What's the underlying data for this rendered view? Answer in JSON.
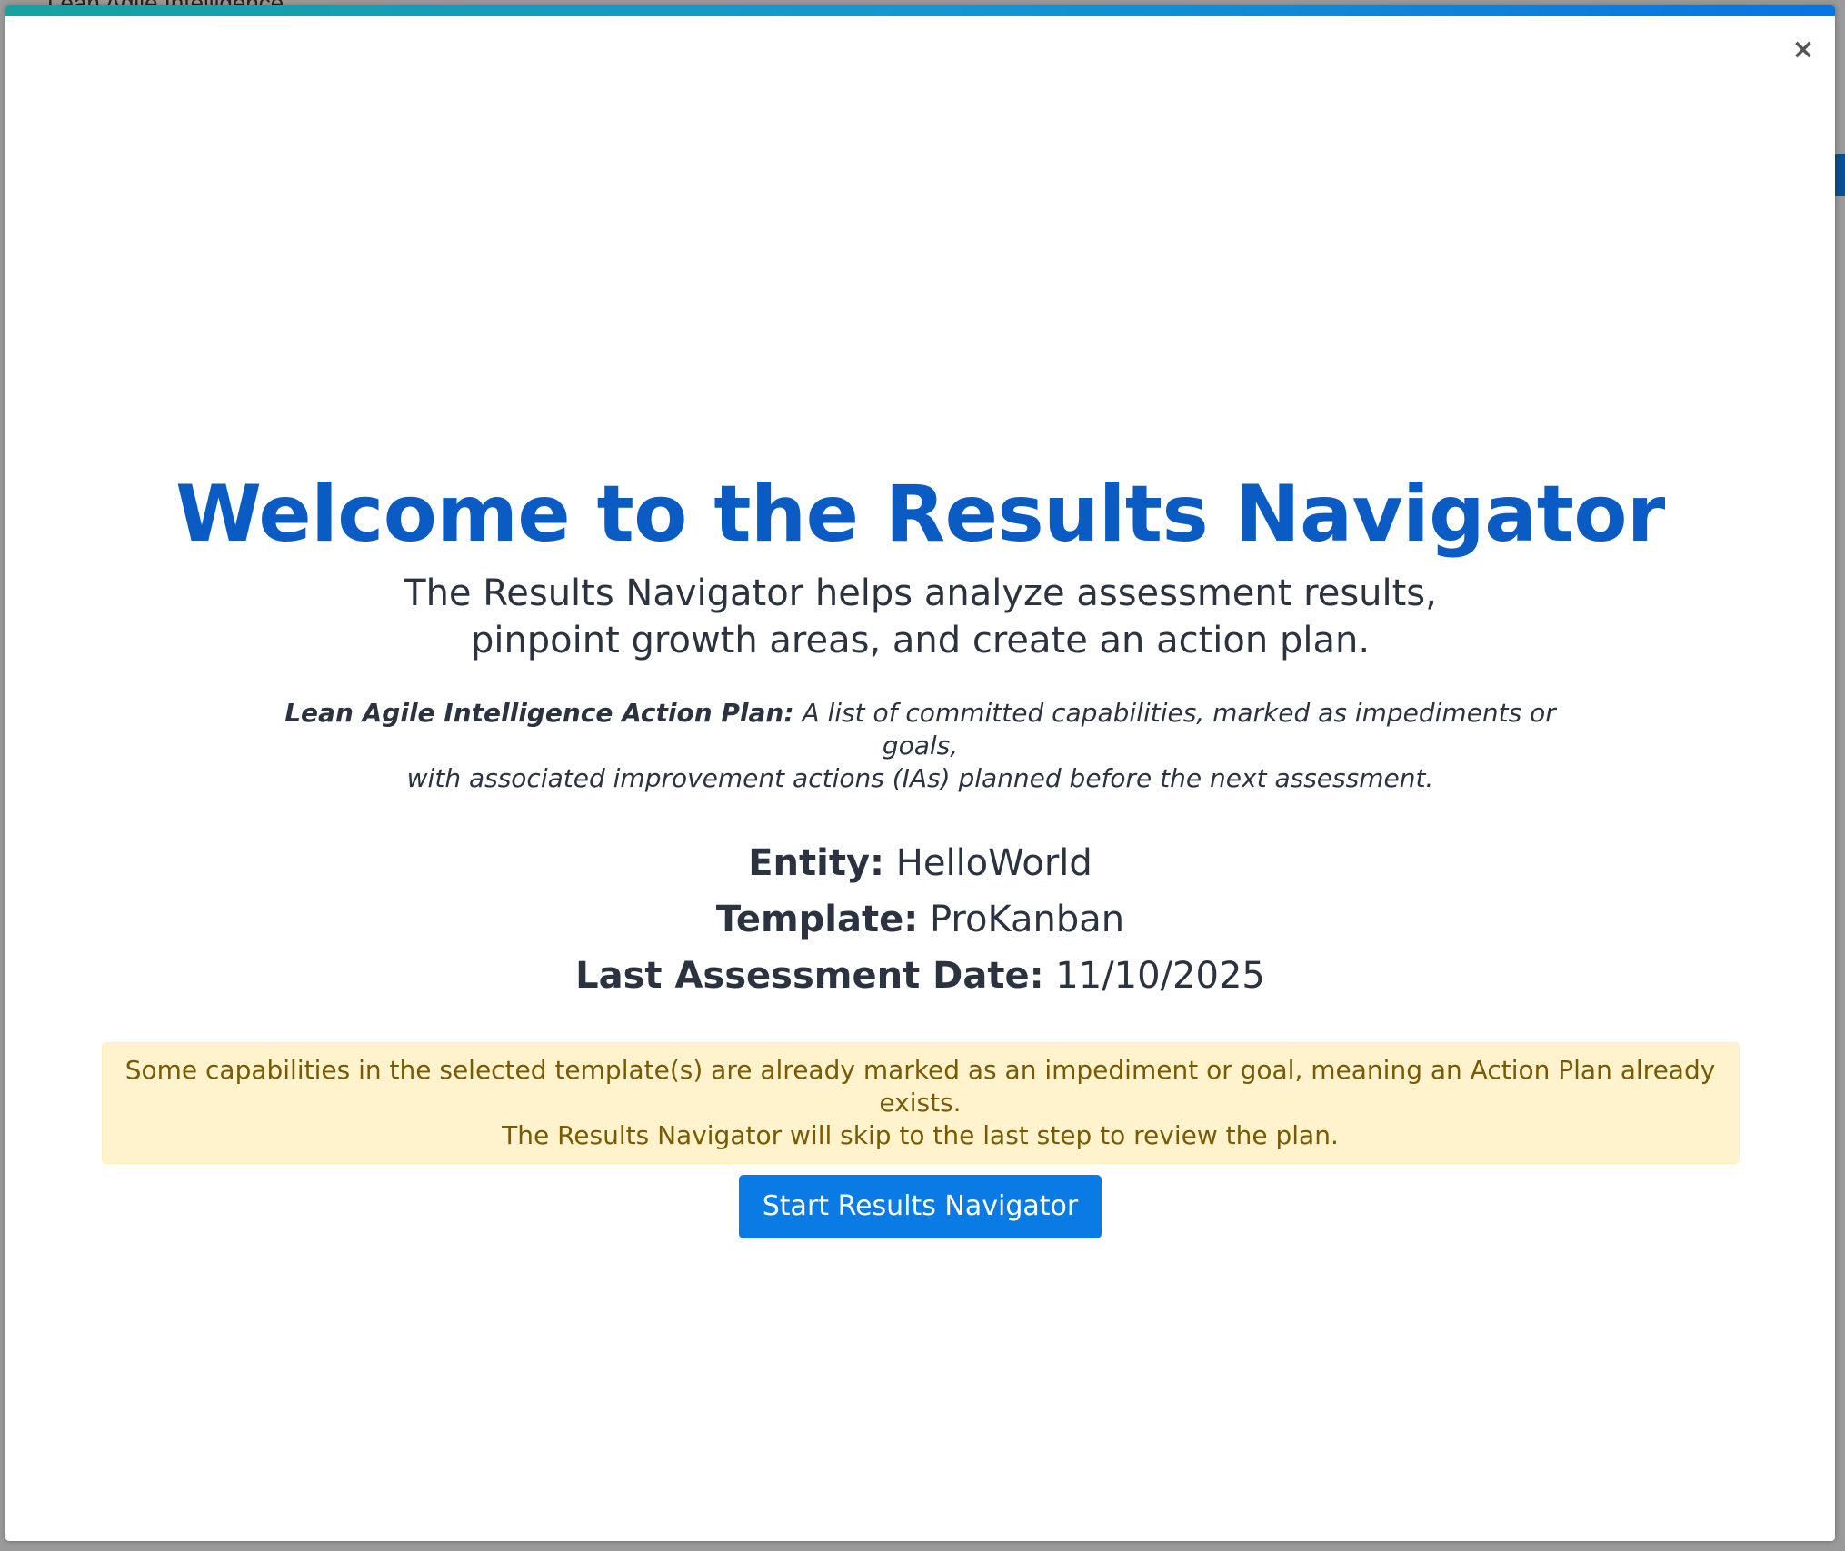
{
  "background": {
    "app_title": "Lean Agile Intelligence"
  },
  "modal": {
    "close_label": "×",
    "title": "Welcome to the Results Navigator",
    "subtitle_line1": "The Results Navigator helps analyze assessment results,",
    "subtitle_line2": "pinpoint growth areas, and create an action plan.",
    "definition_term": "Lean Agile Intelligence Action Plan:",
    "definition_text_line1": " A list of committed capabilities, marked as impediments or goals,",
    "definition_text_line2": "with associated improvement actions (IAs) planned before the next assessment.",
    "meta": {
      "entity_label": "Entity:",
      "entity_value": " HelloWorld",
      "template_label": "Template:",
      "template_value": " ProKanban",
      "date_label": "Last Assessment Date:",
      "date_value": " 11/10/2025"
    },
    "alert_line1": "Some capabilities in the selected template(s) are already marked as an impediment or goal, meaning an Action Plan already exists.",
    "alert_line2": "The Results Navigator will skip to the last step to review the plan.",
    "start_button": "Start Results Navigator"
  },
  "colors": {
    "title": "#0a5cc4",
    "button": "#0a7be5",
    "alert_bg": "#fff3cd",
    "alert_text": "#7a5a00"
  }
}
